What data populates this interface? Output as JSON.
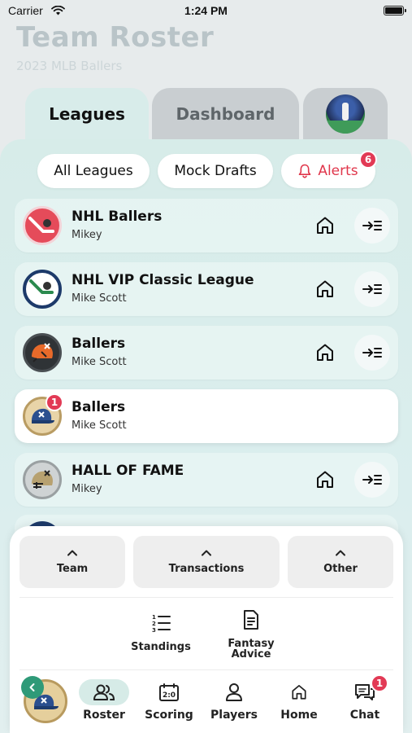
{
  "status_bar": {
    "carrier": "Carrier",
    "time": "1:24 PM"
  },
  "header": {
    "title": "Team Roster",
    "subtitle": "2023 MLB Ballers"
  },
  "tabs": [
    {
      "label": "Leagues",
      "active": true
    },
    {
      "label": "Dashboard",
      "active": false
    },
    {
      "label": "",
      "icon": "team-avatar"
    }
  ],
  "filters": {
    "all_leagues": "All Leagues",
    "mock_drafts": "Mock Drafts",
    "alerts": "Alerts",
    "alerts_count": "6"
  },
  "leagues": [
    {
      "name": "NHL Ballers",
      "owner": "Mikey",
      "logo": "hockey-stick-red"
    },
    {
      "name": "NHL VIP Classic League",
      "owner": "Mike Scott",
      "logo": "hockey-stick-navy"
    },
    {
      "name": "Ballers",
      "owner": "Mike Scott",
      "logo": "football-helmet-orange"
    },
    {
      "name": "Ballers",
      "owner": "Mike Scott",
      "logo": "baseball-cap-gold",
      "badge": "1",
      "selected": true
    },
    {
      "name": "HALL OF FAME",
      "owner": "Mikey",
      "logo": "football-helmet-silver"
    }
  ],
  "bottom_sheet": {
    "categories": [
      {
        "label": "Team"
      },
      {
        "label": "Transactions"
      },
      {
        "label": "Other"
      }
    ],
    "sub_items": [
      {
        "label": "Standings"
      },
      {
        "label_line1": "Fantasy",
        "label_line2": "Advice"
      }
    ]
  },
  "nav": {
    "items": [
      {
        "label": "Roster",
        "active": true
      },
      {
        "label": "Scoring"
      },
      {
        "label": "Players"
      },
      {
        "label": "Home"
      },
      {
        "label": "Chat"
      }
    ],
    "chat_badge": "1"
  },
  "colors": {
    "accent_green": "#2f9a78",
    "alert_red": "#e0364b",
    "badge_red": "#e23a55",
    "panel_mint": "#d7ece9"
  }
}
